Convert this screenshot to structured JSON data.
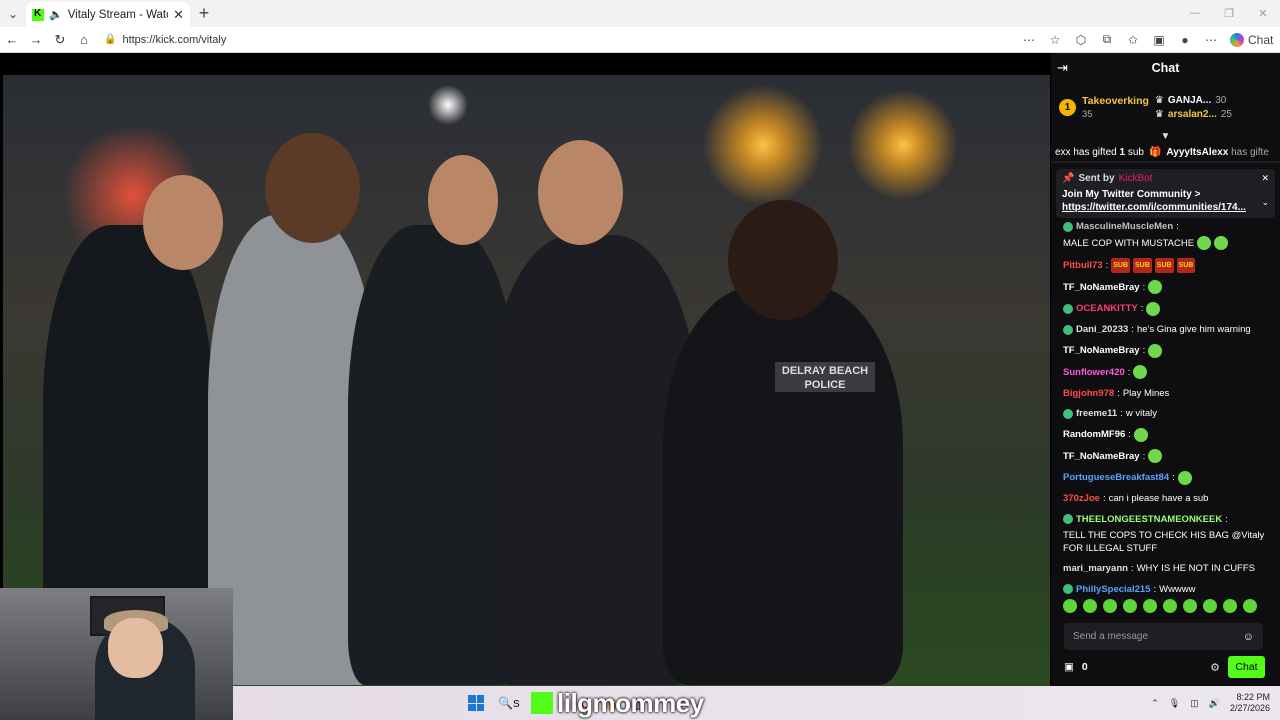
{
  "browser": {
    "tab_title": "Vitaly Stream - Watch Live on",
    "url": "https://kick.com/vitaly",
    "copilot_label": "Chat"
  },
  "chat": {
    "header": "Chat",
    "leaderboard": {
      "rank1": {
        "rank": "1",
        "name": "Takeoverking",
        "count": "35"
      },
      "entry2": {
        "name": "GANJA...",
        "count": "30"
      },
      "entry3": {
        "name": "arsalan2...",
        "count": "25"
      }
    },
    "gift_ticker": {
      "a_user": "exx",
      "a_text": " has gifted ",
      "a_count": "1",
      "a_unit": " sub",
      "b_user": "AyyyItsAlexx",
      "b_text": " has gifte"
    },
    "pinned": {
      "sent_by": "Sent by",
      "sender": "KickBot",
      "line1": "Join My Twitter Community >",
      "link": "https://twitter.com/i/communities/174..."
    },
    "messages": [
      {
        "user": "MasculineMuscleMen",
        "color": "#c0c0c0",
        "text": "MALE COP WITH MUSTACHE",
        "emotes": 2,
        "badge": true
      },
      {
        "user": "Pitbull73",
        "color": "#ff4a4a",
        "text": "",
        "emotes": 0,
        "subs": [
          "SUB",
          "SUB",
          "SUB",
          "SUB"
        ]
      },
      {
        "user": "TF_NoNameBray",
        "color": "#ffffff",
        "text": "",
        "emotes": 1
      },
      {
        "user": "OCEANKITTY",
        "color": "#ff3b7a",
        "text": "",
        "emotes": 1,
        "badge": true
      },
      {
        "user": "Dani_20233",
        "color": "#e0e0e0",
        "text": "he's Gina give him warning",
        "emotes": 0,
        "badge": true
      },
      {
        "user": "TF_NoNameBray",
        "color": "#ffffff",
        "text": "",
        "emotes": 1
      },
      {
        "user": "Sunflower420",
        "color": "#ff5adc",
        "text": "",
        "emotes": 1
      },
      {
        "user": "Bigjohn978",
        "color": "#ff4a4a",
        "text": "Play Mines",
        "emotes": 0
      },
      {
        "user": "freeme11",
        "color": "#e0e0e0",
        "text": "w vitaly",
        "emotes": 0,
        "badge": true
      },
      {
        "user": "RandomMF96",
        "color": "#ffffff",
        "text": "",
        "emotes": 1
      },
      {
        "user": "TF_NoNameBray",
        "color": "#ffffff",
        "text": "",
        "emotes": 1
      },
      {
        "user": "PortugueseBreakfast84",
        "color": "#5aa2ff",
        "text": "",
        "emotes": 1
      },
      {
        "user": "370zJoe",
        "color": "#ff4a4a",
        "text": "can i please have a sub",
        "emotes": 0
      },
      {
        "user": "THEELONGEESTNAMEONKEEK",
        "color": "#9bff74",
        "text": "TELL THE COPS TO CHECK HIS BAG @Vitaly FOR ILLEGAL STUFF",
        "emotes": 0,
        "badge": true
      },
      {
        "user": "mari_maryann",
        "color": "#e0e0e0",
        "text": "WHY IS HE NOT IN CUFFS",
        "emotes": 0
      },
      {
        "user": "PhillySpecial215",
        "color": "#5aa2ff",
        "text": "Wwwww",
        "emotes": 0,
        "badge": true
      }
    ],
    "input_placeholder": "Send a message",
    "points": "0",
    "send_label": "Chat"
  },
  "stream_overlay": {
    "name": "lilgmommey"
  },
  "taskbar": {
    "search_label": "S",
    "time": "8:22 PM",
    "date": "2/27/2026"
  },
  "colors": {
    "kick_green": "#53fc18",
    "chat_bg": "#0e0e10"
  }
}
